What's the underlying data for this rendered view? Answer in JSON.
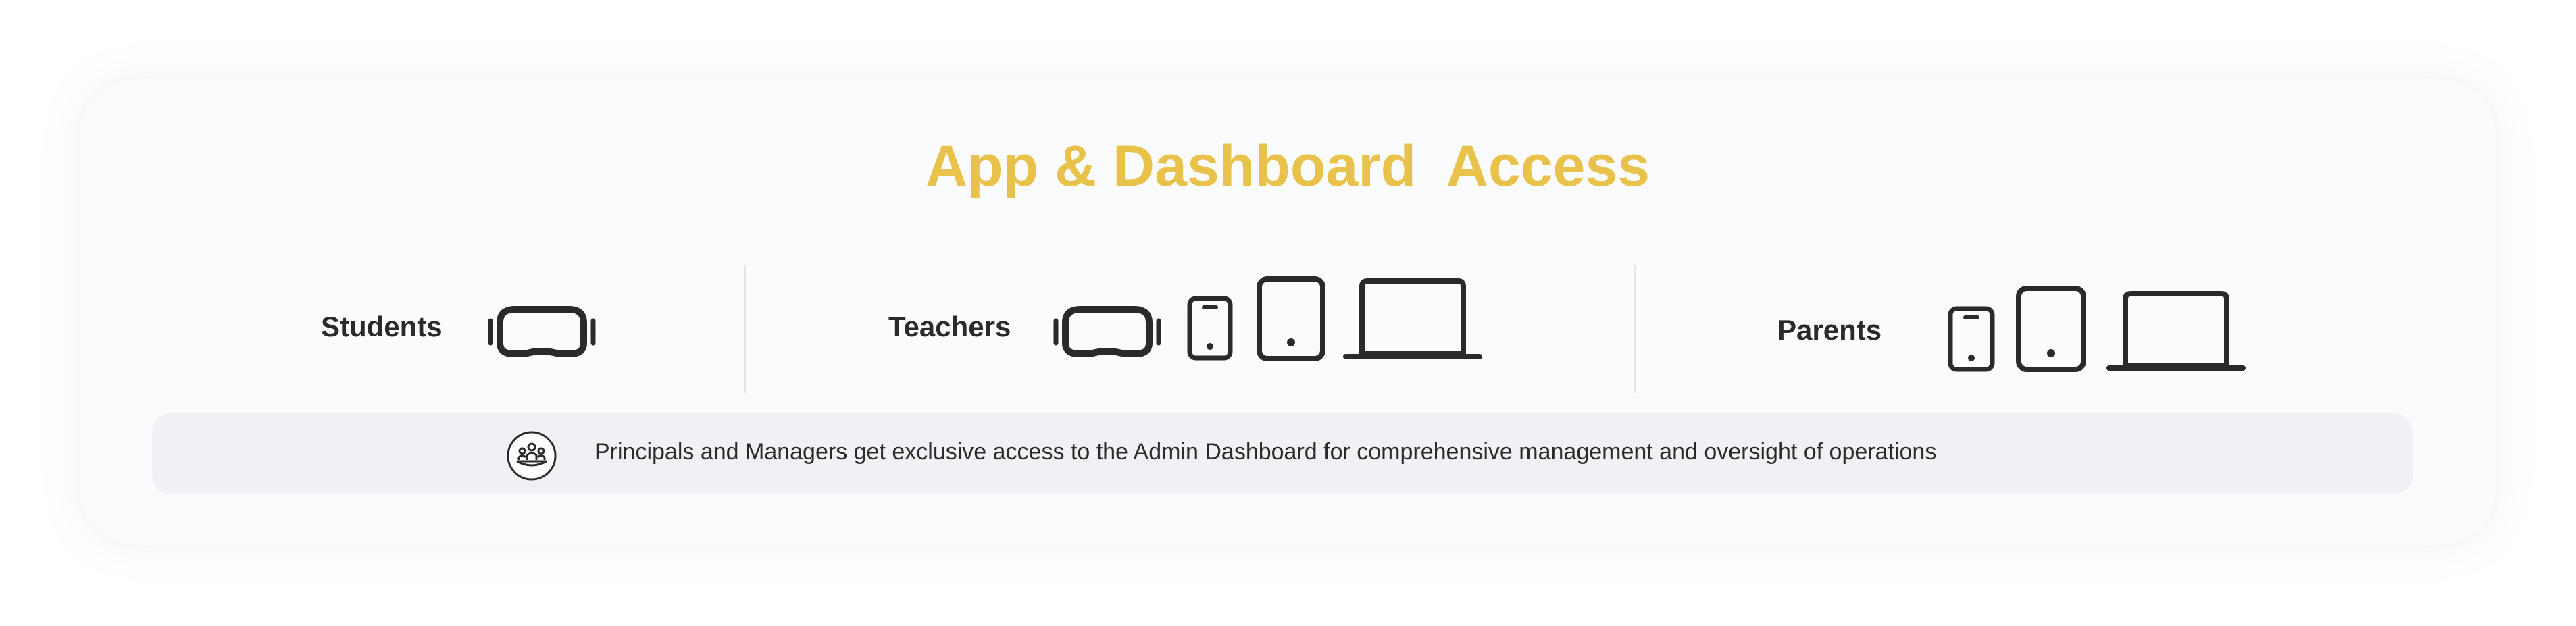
{
  "header": {
    "title": "App & Dashboard  Access"
  },
  "groups": [
    {
      "label": "Students",
      "devices": [
        "vr-headset-icon"
      ]
    },
    {
      "label": "Teachers",
      "devices": [
        "vr-headset-icon",
        "smartphone-icon",
        "tablet-icon",
        "laptop-icon"
      ]
    },
    {
      "label": "Parents",
      "devices": [
        "smartphone-icon",
        "tablet-icon",
        "laptop-icon"
      ]
    }
  ],
  "note": {
    "icon": "group-people-icon",
    "text": "Principals and Managers get exclusive access to the Admin Dashboard for comprehensive management and oversight of operations"
  },
  "colors": {
    "accent": "#e8c24a",
    "text": "#2a2a2a",
    "card_background": "#fafbfc",
    "note_background": "#f0f1f4"
  }
}
